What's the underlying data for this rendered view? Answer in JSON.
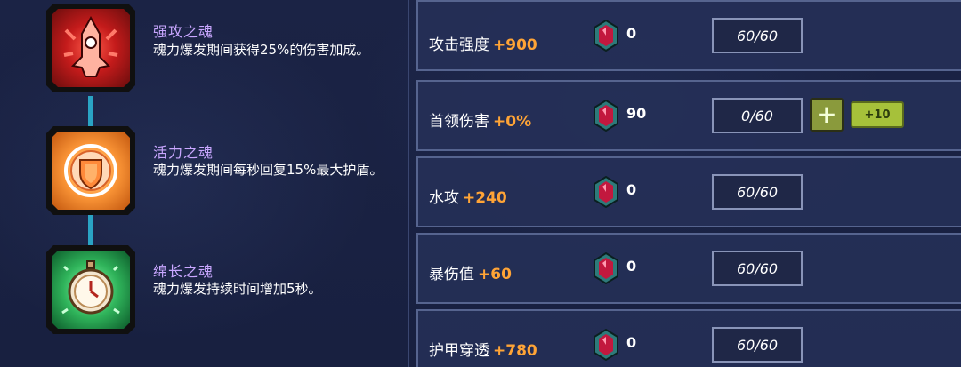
{
  "souls": [
    {
      "name": "强攻之魂",
      "desc": "魂力爆发期间获得25%的伤害加成。",
      "theme": "red",
      "icon": "attack-soul-icon"
    },
    {
      "name": "活力之魂",
      "desc": "魂力爆发期间每秒回复15%最大护盾。",
      "theme": "orange",
      "icon": "shield-soul-icon"
    },
    {
      "name": "绵长之魂",
      "desc": "魂力爆发持续时间增加5秒。",
      "theme": "green",
      "icon": "timer-soul-icon"
    }
  ],
  "stats": [
    {
      "label": "攻击强度",
      "bonus": "+900",
      "gems": "0",
      "progress": "60/60",
      "upgradable": false
    },
    {
      "label": "首领伤害",
      "bonus": "+0%",
      "gems": "90",
      "progress": "0/60",
      "upgradable": true,
      "plus10": "+10"
    },
    {
      "label": "水攻",
      "bonus": "+240",
      "gems": "0",
      "progress": "60/60",
      "upgradable": false
    },
    {
      "label": "暴伤值",
      "bonus": "+60",
      "gems": "0",
      "progress": "60/60",
      "upgradable": false
    },
    {
      "label": "护甲穿透",
      "bonus": "+780",
      "gems": "0",
      "progress": "60/60",
      "upgradable": false
    }
  ],
  "colors": {
    "soul_name": "#c9a7ff",
    "bonus": "#ffa436",
    "connector": "#2aa4c4"
  }
}
